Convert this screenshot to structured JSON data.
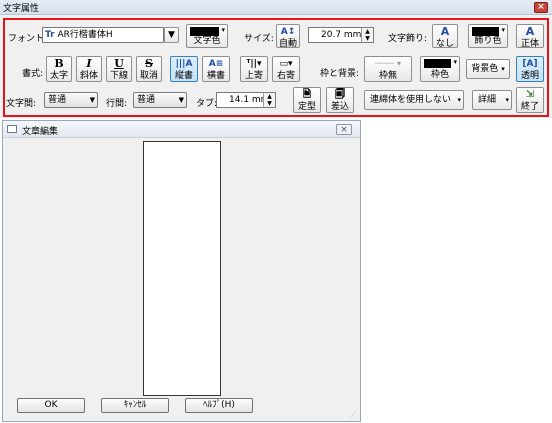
{
  "dialog": {
    "title": "文字属性",
    "close_glyph": "×"
  },
  "row1": {
    "font_label": "フォント:",
    "font_icon": "Tr",
    "font_value": "AR行楷書体H",
    "text_color_label": "文字色",
    "size_label": "サイズ:",
    "size_auto_label": "自動",
    "size_value": "20.7 mm",
    "outline_label": "文字飾り:",
    "outline_none_label": "なし",
    "outline_color_label": "飾り色",
    "upright_label": "正体"
  },
  "row2": {
    "style_label": "書式:",
    "bold_icon": "B",
    "bold_label": "太字",
    "italic_icon": "I",
    "italic_label": "斜体",
    "underline_icon": "U",
    "underline_label": "下線",
    "strike_icon": "S",
    "strike_label": "取消",
    "vertical_label": "縦書",
    "horizontal_label": "横書",
    "top_align_label": "上寄",
    "right_align_label": "右寄",
    "frame_bg_label": "枠と背景:",
    "no_frame_label": "枠無",
    "frame_color_label": "枠色",
    "bg_color_label": "背景色",
    "transparent_label": "透明"
  },
  "row3": {
    "char_spacing_label": "文字間:",
    "char_spacing_value": "普通",
    "line_spacing_label": "行間:",
    "line_spacing_value": "普通",
    "tab_label": "タブ:",
    "tab_value": "14.1 mm",
    "fixed_label": "定型",
    "insert_label": "差込",
    "renmen_value": "連綿体を使用しない",
    "detail_label": "詳細",
    "finish_label": "終了"
  },
  "editor": {
    "title": "文章編集",
    "close_glyph": "×",
    "ok_label": "OK",
    "cancel_label": "ｷｬﾝｾﾙ",
    "help_label": "ﾍﾙﾌﾟ(H)"
  },
  "colors": {
    "accent_frame": "#e4141c",
    "swatch": "#000000"
  }
}
